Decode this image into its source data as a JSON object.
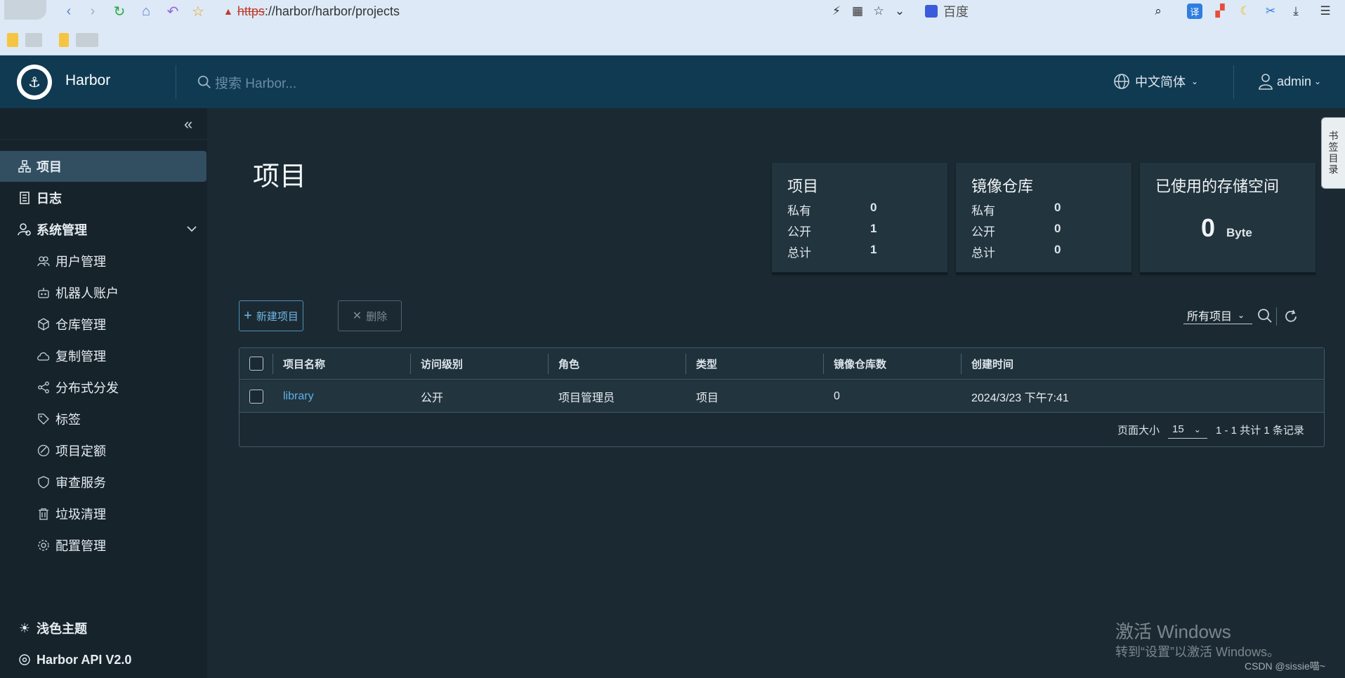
{
  "browser": {
    "url": "https://harbor/harbor/projects",
    "url_proto": "https",
    "url_rest": "://harbor/harbor/projects",
    "search_engine": "百度"
  },
  "header": {
    "app_title": "Harbor",
    "search_placeholder": "搜索 Harbor...",
    "language": "中文简体",
    "user": "admin"
  },
  "sidebar": {
    "items": [
      {
        "label": "项目",
        "icon": "projects-icon"
      },
      {
        "label": "日志",
        "icon": "logs-icon"
      },
      {
        "label": "系统管理",
        "icon": "admin-icon"
      },
      {
        "label": "用户管理",
        "icon": "users-icon"
      },
      {
        "label": "机器人账户",
        "icon": "robot-icon"
      },
      {
        "label": "仓库管理",
        "icon": "registry-icon"
      },
      {
        "label": "复制管理",
        "icon": "replication-icon"
      },
      {
        "label": "分布式分发",
        "icon": "distribution-icon"
      },
      {
        "label": "标签",
        "icon": "tag-icon"
      },
      {
        "label": "项目定额",
        "icon": "quota-icon"
      },
      {
        "label": "审查服务",
        "icon": "shield-icon"
      },
      {
        "label": "垃圾清理",
        "icon": "trash-icon"
      },
      {
        "label": "配置管理",
        "icon": "gear-icon"
      }
    ],
    "footer": [
      {
        "label": "浅色主题",
        "icon": "sun-icon"
      },
      {
        "label": "Harbor API V2.0",
        "icon": "api-icon"
      }
    ]
  },
  "main": {
    "page_title": "项目",
    "cards": {
      "projects": {
        "title": "项目",
        "rows": [
          {
            "label": "私有",
            "value": "0"
          },
          {
            "label": "公开",
            "value": "1"
          },
          {
            "label": "总计",
            "value": "1"
          }
        ]
      },
      "repos": {
        "title": "镜像仓库",
        "rows": [
          {
            "label": "私有",
            "value": "0"
          },
          {
            "label": "公开",
            "value": "0"
          },
          {
            "label": "总计",
            "value": "0"
          }
        ]
      },
      "storage": {
        "title": "已使用的存储空间",
        "value": "0",
        "unit": "Byte"
      }
    },
    "buttons": {
      "new_project": "新建项目",
      "delete": "删除"
    },
    "filter": "所有项目",
    "table": {
      "headers": [
        "项目名称",
        "访问级别",
        "角色",
        "类型",
        "镜像仓库数",
        "创建时间"
      ],
      "rows": [
        {
          "name": "library",
          "access": "公开",
          "role": "项目管理员",
          "type": "项目",
          "repo_count": "0",
          "created": "2024/3/23 下午7:41"
        }
      ],
      "footer": {
        "page_size_label": "页面大小",
        "page_size": "15",
        "count_text": "1 - 1 共计 1 条记录"
      }
    }
  },
  "edge_tab": "书签目录",
  "watermark": {
    "line1": "激活 Windows",
    "line2": "转到“设置”以激活 Windows。",
    "csdn": "CSDN @sissie喵~"
  },
  "colors": {
    "header_bg": "#0f3a52",
    "sidebar_bg": "#17232b",
    "content_bg": "#1b2a32",
    "active_item": "#324f62",
    "link": "#5eb1e8"
  }
}
